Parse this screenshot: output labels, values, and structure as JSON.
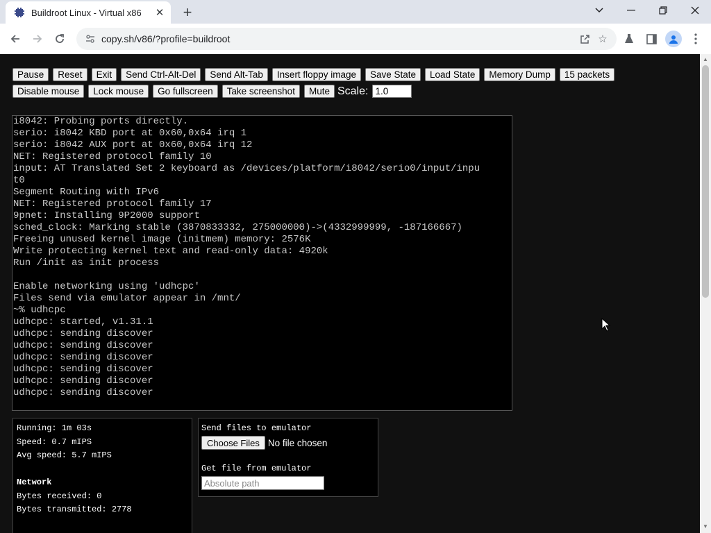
{
  "browser": {
    "tab_title": "Buildroot Linux - Virtual x86",
    "url": "copy.sh/v86/?profile=buildroot",
    "icons": [
      "back-icon",
      "forward-icon",
      "reload-icon",
      "share-icon",
      "star-icon",
      "labs-icon",
      "sidepanel-icon",
      "profile-icon",
      "menu-icon"
    ]
  },
  "controls": {
    "row1": [
      "Pause",
      "Reset",
      "Exit",
      "Send Ctrl-Alt-Del",
      "Send Alt-Tab",
      "Insert floppy image",
      "Save State",
      "Load State",
      "Memory Dump",
      "15 packets"
    ],
    "row2": [
      "Disable mouse",
      "Lock mouse",
      "Go fullscreen",
      "Take screenshot",
      "Mute"
    ],
    "scale_label": "Scale:",
    "scale_value": "1.0"
  },
  "terminal": {
    "lines": [
      "i8042: Probing ports directly.",
      "serio: i8042 KBD port at 0x60,0x64 irq 1",
      "serio: i8042 AUX port at 0x60,0x64 irq 12",
      "NET: Registered protocol family 10",
      "input: AT Translated Set 2 keyboard as /devices/platform/i8042/serio0/input/inpu",
      "t0",
      "Segment Routing with IPv6",
      "NET: Registered protocol family 17",
      "9pnet: Installing 9P2000 support",
      "sched_clock: Marking stable (3870833332, 275000000)->(4332999999, -187166667)",
      "Freeing unused kernel image (initmem) memory: 2576K",
      "Write protecting kernel text and read-only data: 4920k",
      "Run /init as init process",
      "",
      "Enable networking using 'udhcpc'",
      "Files send via emulator appear in /mnt/",
      "~% udhcpc",
      "udhcpc: started, v1.31.1",
      "udhcpc: sending discover",
      "udhcpc: sending discover",
      "udhcpc: sending discover",
      "udhcpc: sending discover",
      "udhcpc: sending discover",
      "udhcpc: sending discover"
    ]
  },
  "info": {
    "running": "Running: 1m 03s",
    "speed": "Speed: 0.7 mIPS",
    "avg_speed": "Avg speed: 5.7 mIPS",
    "network_heading": "Network",
    "bytes_received": "Bytes received: 0",
    "bytes_transmitted": "Bytes transmitted: 2778"
  },
  "files": {
    "send_label": "Send files to emulator",
    "choose_button": "Choose Files",
    "no_file": "No file chosen",
    "get_label": "Get file from emulator",
    "path_placeholder": "Absolute path"
  }
}
